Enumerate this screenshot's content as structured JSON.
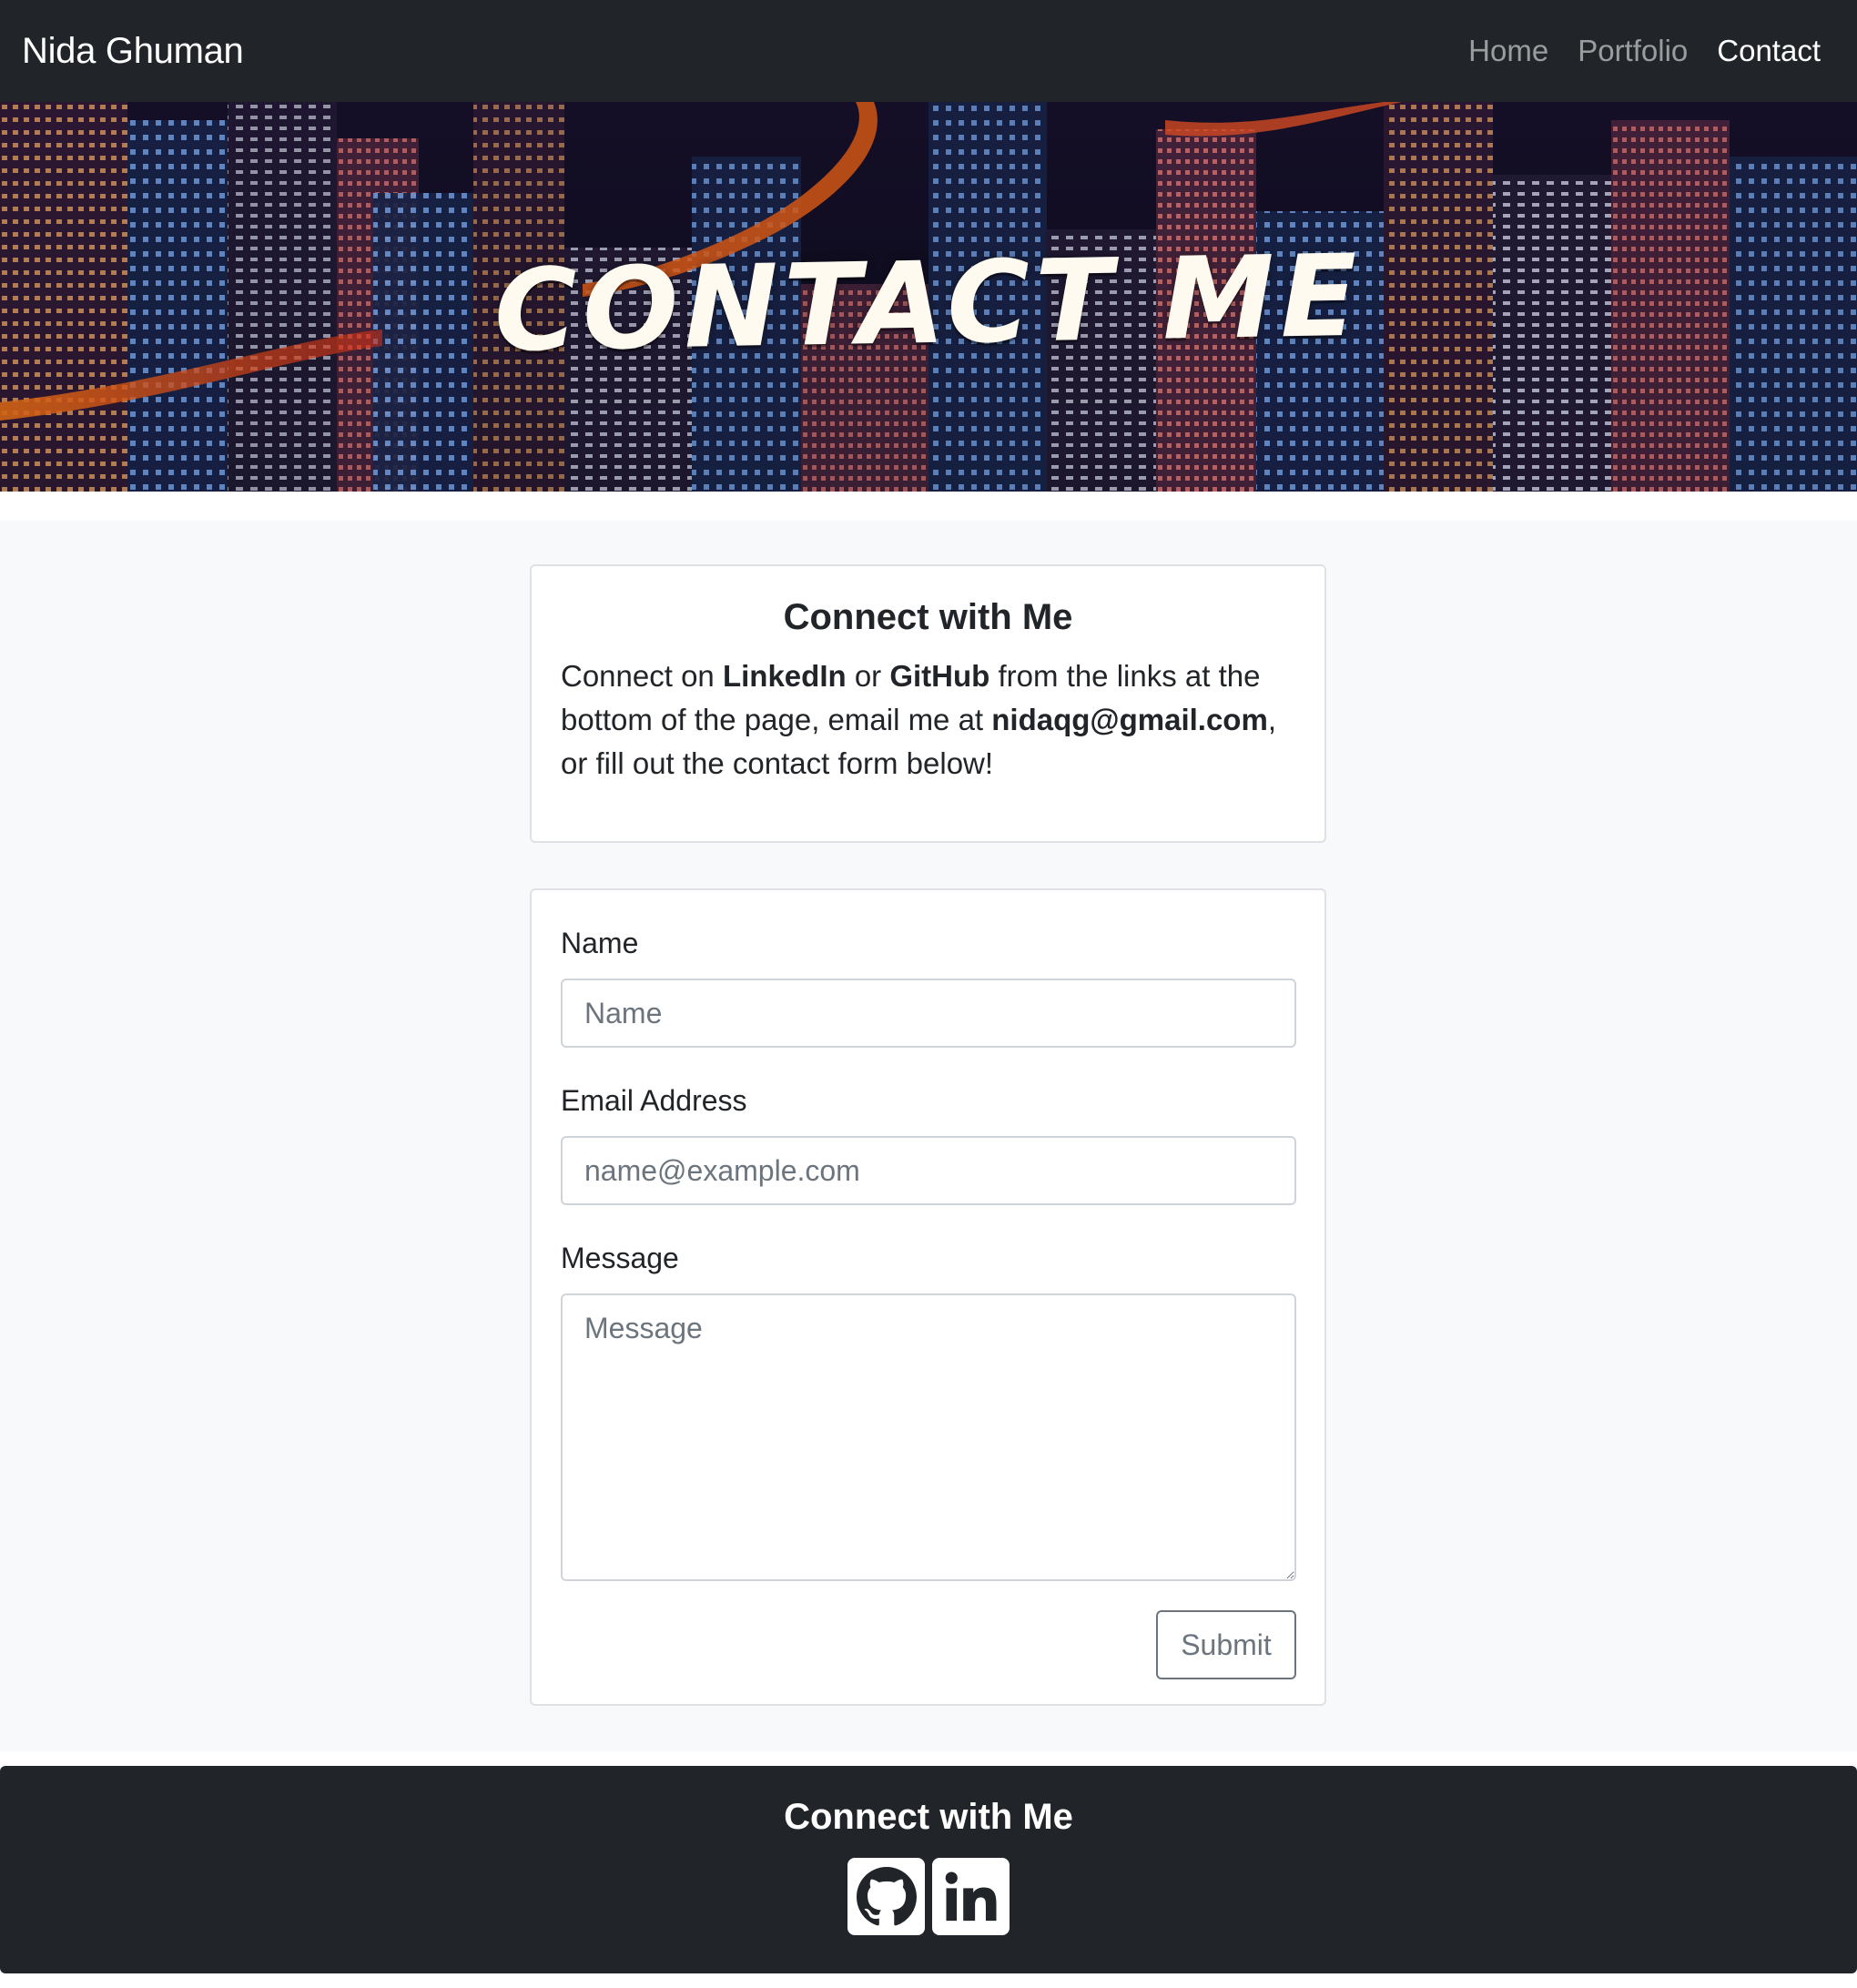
{
  "navbar": {
    "brand": "Nida Ghuman",
    "links": [
      {
        "label": "Home"
      },
      {
        "label": "Portfolio"
      },
      {
        "label": "Contact",
        "active": true
      }
    ]
  },
  "hero": {
    "title": "CONTACT ME",
    "background": "night city skyline"
  },
  "intro": {
    "title": "Connect with Me",
    "text_1": "Connect on ",
    "linkedin": "LinkedIn",
    "text_2": " or ",
    "github": "GitHub",
    "text_3": " from the links at the bottom of the page, email me at ",
    "email": "nidaqg@gmail.com",
    "text_4": ", or fill out the contact form below!"
  },
  "form": {
    "name_label": "Name",
    "name_placeholder": "Name",
    "email_label": "Email Address",
    "email_placeholder": "name@example.com",
    "message_label": "Message",
    "message_placeholder": "Message",
    "submit_label": "Submit"
  },
  "footer": {
    "title": "Connect with Me",
    "icons": [
      "github-icon",
      "linkedin-icon"
    ]
  },
  "colors": {
    "navbar_bg": "#212529",
    "page_bg": "#f8f9fa",
    "nav_inactive": "rgba(255,255,255,0.55)",
    "button_outline": "#6c757d"
  }
}
